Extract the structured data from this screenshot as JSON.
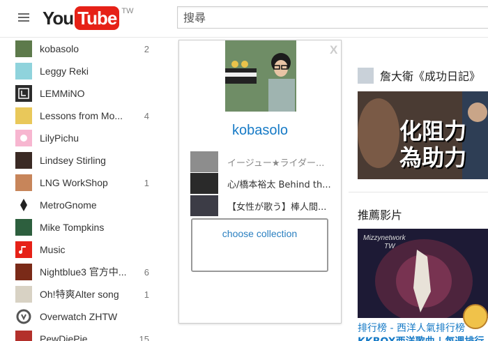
{
  "header": {
    "logo_you": "You",
    "logo_tube": "Tube",
    "logo_region": "TW",
    "search_placeholder": "搜尋"
  },
  "sidebar": {
    "items": [
      {
        "label": "kobasolo",
        "count": "2",
        "icon": "kobasolo-thumbnail"
      },
      {
        "label": "Leggy Reki",
        "count": "",
        "icon": "leggy-reki-thumbnail"
      },
      {
        "label": "LEMMiNO",
        "count": "",
        "icon": "lemmino-logo"
      },
      {
        "label": "Lessons from Mo...",
        "count": "4",
        "icon": "lessons-thumbnail"
      },
      {
        "label": "LilyPichu",
        "count": "",
        "icon": "lilypichu-thumbnail"
      },
      {
        "label": "Lindsey Stirling",
        "count": "",
        "icon": "lindsey-thumbnail"
      },
      {
        "label": "LNG WorkShop",
        "count": "1",
        "icon": "lng-thumbnail"
      },
      {
        "label": "MetroGnome",
        "count": "",
        "icon": "metrognome-logo"
      },
      {
        "label": "Mike Tompkins",
        "count": "",
        "icon": "mike-thumbnail"
      },
      {
        "label": "Music",
        "count": "",
        "icon": "music-note-icon"
      },
      {
        "label": "Nightblue3 官方中...",
        "count": "6",
        "icon": "nightblue-thumbnail"
      },
      {
        "label": "Oh!特爽Alter song",
        "count": "1",
        "icon": "oh-thumbnail"
      },
      {
        "label": "Overwatch ZHTW",
        "count": "",
        "icon": "overwatch-logo"
      },
      {
        "label": "PewDiePie",
        "count": "15",
        "icon": "pewdiepie-thumbnail"
      }
    ]
  },
  "popup": {
    "close_label": "X",
    "channel_name": "kobasolo",
    "videos": [
      {
        "title": "イージュー★ライダー..."
      },
      {
        "title": "心/橋本裕太 Behind th..."
      },
      {
        "title": "【女性が歌う】棒人間..."
      }
    ],
    "collection_label": "choose collection"
  },
  "right": {
    "rec_channel_title": "詹大衛《成功日記》",
    "thumb1_line1": "化阻力",
    "thumb1_line2": "為助力",
    "section_title": "推薦影片",
    "thumb2_watermark_1": "Mizzynetwork",
    "thumb2_watermark_2": "TW",
    "video_link_1": "排行榜 - 西洋人氣排行榜",
    "video_link_2": "KKBOX西洋歌曲 | 每週排行"
  },
  "colors": {
    "youtube_red": "#e62117",
    "link_blue": "#167ac6"
  }
}
